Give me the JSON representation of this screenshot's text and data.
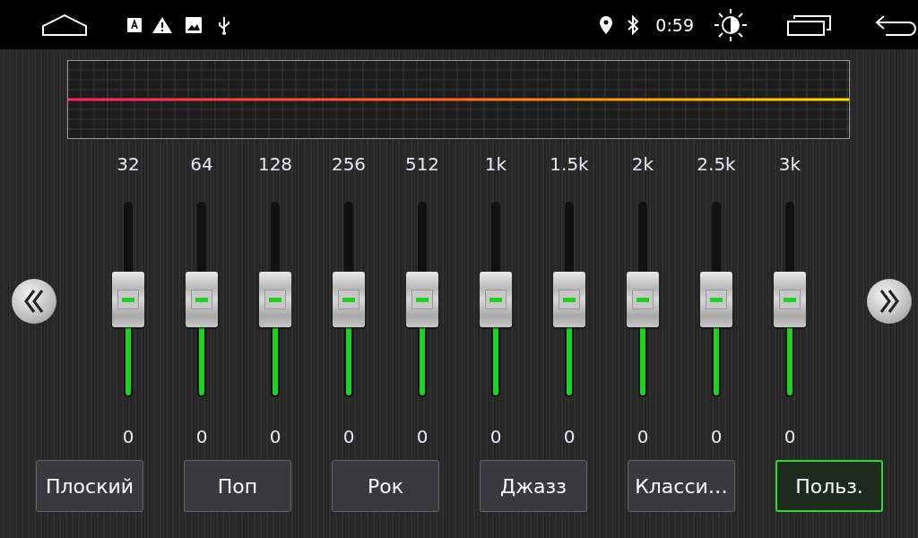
{
  "status_bar": {
    "time": "0:59"
  },
  "bands": [
    {
      "freq": "32",
      "value": "0",
      "level": 0.5
    },
    {
      "freq": "64",
      "value": "0",
      "level": 0.5
    },
    {
      "freq": "128",
      "value": "0",
      "level": 0.5
    },
    {
      "freq": "256",
      "value": "0",
      "level": 0.5
    },
    {
      "freq": "512",
      "value": "0",
      "level": 0.5
    },
    {
      "freq": "1k",
      "value": "0",
      "level": 0.5
    },
    {
      "freq": "1.5k",
      "value": "0",
      "level": 0.5
    },
    {
      "freq": "2k",
      "value": "0",
      "level": 0.5
    },
    {
      "freq": "2.5k",
      "value": "0",
      "level": 0.5
    },
    {
      "freq": "3k",
      "value": "0",
      "level": 0.5
    }
  ],
  "presets": [
    {
      "label": "Плоский",
      "selected": false
    },
    {
      "label": "Поп",
      "selected": false
    },
    {
      "label": "Рок",
      "selected": false
    },
    {
      "label": "Джазз",
      "selected": false
    },
    {
      "label": "Класси…",
      "selected": false
    },
    {
      "label": "Польз.",
      "selected": true
    }
  ]
}
